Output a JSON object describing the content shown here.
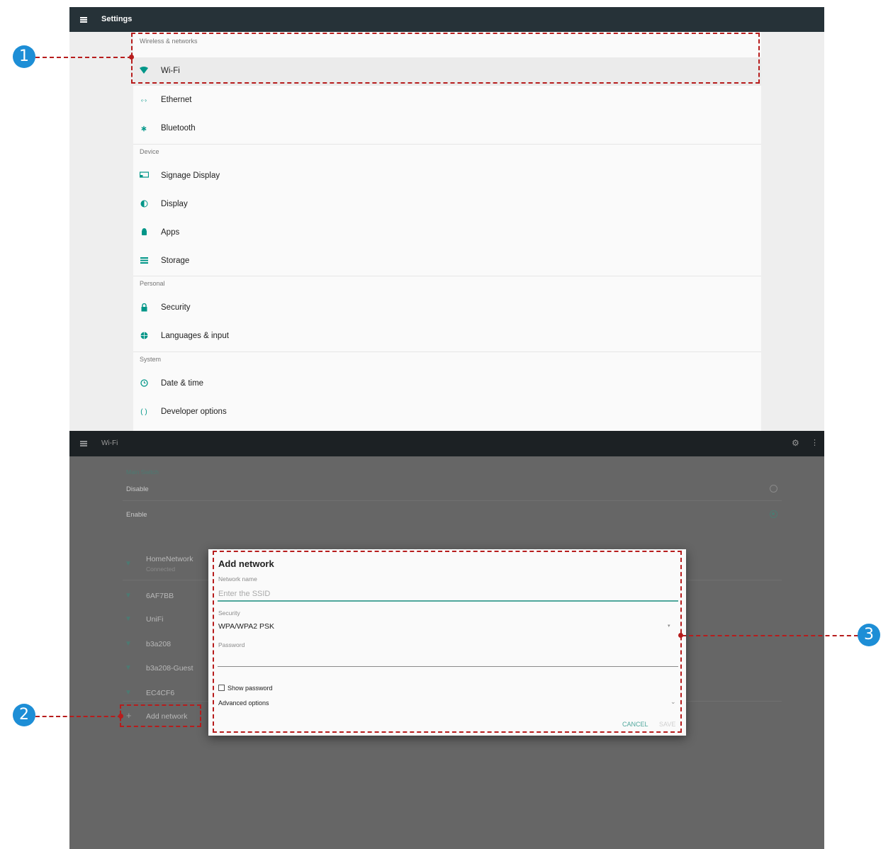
{
  "settings": {
    "title": "Settings",
    "sections": [
      {
        "header": "Wireless & networks",
        "items": [
          {
            "label": "Wi-Fi",
            "icon": "wifi-icon"
          },
          {
            "label": "Ethernet",
            "icon": "ethernet-icon"
          },
          {
            "label": "Bluetooth",
            "icon": "bluetooth-icon"
          }
        ]
      },
      {
        "header": "Device",
        "items": [
          {
            "label": "Signage Display",
            "icon": "signage-display-icon"
          },
          {
            "label": "Display",
            "icon": "display-brightness-icon"
          },
          {
            "label": "Apps",
            "icon": "android-icon"
          },
          {
            "label": "Storage",
            "icon": "storage-icon"
          }
        ]
      },
      {
        "header": "Personal",
        "items": [
          {
            "label": "Security",
            "icon": "lock-icon"
          },
          {
            "label": "Languages & input",
            "icon": "globe-icon"
          }
        ]
      },
      {
        "header": "System",
        "items": [
          {
            "label": "Date & time",
            "icon": "clock-icon"
          },
          {
            "label": "Developer options",
            "icon": "code-brackets-icon"
          }
        ]
      }
    ]
  },
  "wifi": {
    "title": "Wi-Fi",
    "main_switch_label": "Main Switch",
    "disable_label": "Disable",
    "enable_label": "Enable",
    "selected": "Enable",
    "networks": [
      {
        "name": "HomeNetwork",
        "status": "Connected"
      },
      {
        "name": "6AF7BB"
      },
      {
        "name": "UniFi"
      },
      {
        "name": "b3a208"
      },
      {
        "name": "b3a208-Guest"
      },
      {
        "name": "EC4CF6"
      }
    ],
    "add_network_label": "Add network"
  },
  "dialog": {
    "title": "Add network",
    "network_name_label": "Network name",
    "network_name_placeholder": "Enter the SSID",
    "security_label": "Security",
    "security_value": "WPA/WPA2 PSK",
    "password_label": "Password",
    "show_password_label": "Show password",
    "advanced_options_label": "Advanced options",
    "cancel_label": "CANCEL",
    "save_label": "SAVE"
  },
  "annotations": [
    "1",
    "2",
    "3"
  ],
  "colors": {
    "accent": "#009688",
    "annotation": "#b71c1c",
    "badge": "#1d8ed6",
    "appbar": "#263238"
  }
}
